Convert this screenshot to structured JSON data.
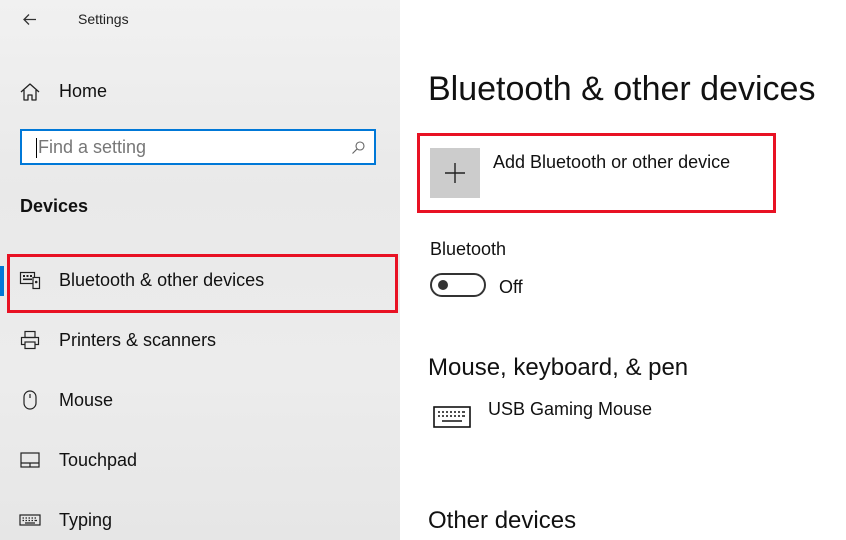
{
  "window": {
    "title": "Settings"
  },
  "sidebar": {
    "home_label": "Home",
    "search": {
      "placeholder": "Find a setting"
    },
    "section_title": "Devices",
    "items": [
      {
        "label": "Bluetooth & other devices",
        "icon": "bluetooth-devices-icon",
        "selected": true
      },
      {
        "label": "Printers & scanners",
        "icon": "printer-icon"
      },
      {
        "label": "Mouse",
        "icon": "mouse-icon"
      },
      {
        "label": "Touchpad",
        "icon": "touchpad-icon"
      },
      {
        "label": "Typing",
        "icon": "keyboard-icon"
      }
    ]
  },
  "main": {
    "title": "Bluetooth & other devices",
    "add_device_label": "Add Bluetooth or other device",
    "bluetooth": {
      "label": "Bluetooth",
      "state": "Off"
    },
    "mouse_section": {
      "title": "Mouse, keyboard, & pen",
      "devices": [
        {
          "name": "USB Gaming Mouse",
          "icon": "keyboard-icon"
        }
      ]
    },
    "other_section": {
      "title": "Other devices"
    }
  },
  "colors": {
    "accent": "#0078d7",
    "highlight": "#e81123",
    "sidebar_bg": "#ececec"
  }
}
